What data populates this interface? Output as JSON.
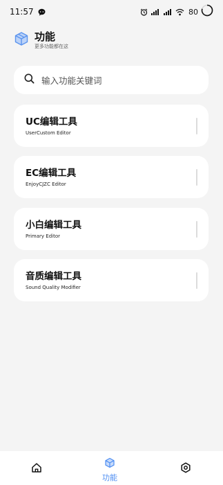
{
  "status_bar": {
    "time": "11:57",
    "battery": "80"
  },
  "header": {
    "title": "功能",
    "subtitle": "更多功能都在这"
  },
  "search": {
    "placeholder": "输入功能关键词"
  },
  "tools": [
    {
      "title": "UC编辑工具",
      "subtitle": "UserCustom Editor"
    },
    {
      "title": "EC编辑工具",
      "subtitle": "EnjoyCJZC Editor"
    },
    {
      "title": "小白编辑工具",
      "subtitle": "Primary Editor"
    },
    {
      "title": "音质编辑工具",
      "subtitle": "Sound Quality Modifier"
    }
  ],
  "bottom_nav": {
    "active_label": "功能"
  },
  "colors": {
    "accent": "#4e8ef2",
    "background": "#f4f4f4",
    "card": "#ffffff"
  }
}
